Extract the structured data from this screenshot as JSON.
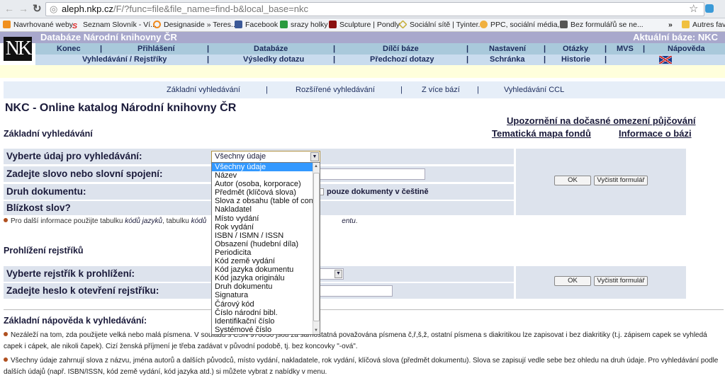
{
  "browser": {
    "url_host": "aleph.nkp.cz",
    "url_path": "/F/?func=file&file_name=find-b&local_base=nkc",
    "bookmarks": [
      "Navrhované weby",
      "Seznam Slovník - Ví...",
      "Designaside » Teres...",
      "Facebook",
      "srazy holky",
      "Sculpture | Pondly",
      "Sociální sítě | Tyinter...",
      "PPC, sociální média,...",
      "Bez formulářů se ne...",
      "»",
      "Autres favo"
    ]
  },
  "header": {
    "title": "Databáze Národní knihovny ČR",
    "current_base": "Aktuální báze:  NKC",
    "logo": "NK"
  },
  "nav1": [
    "Konec",
    "Přihlášení",
    "Databáze",
    "Dílčí báze",
    "Nastavení",
    "Otázky",
    "MVS",
    "Nápověda"
  ],
  "nav2": [
    "Vyhledávání / Rejstříky",
    "Výsledky dotazu",
    "Předchozí dotazy",
    "Schránka",
    "Historie"
  ],
  "submenu": [
    "Základní vyhledávání",
    "Rozšířené vyhledávání",
    "Z více bází",
    "Vyhledávání CCL"
  ],
  "page_title": "NKC -  Online katalog Národní knihovny ČR",
  "links": {
    "notice": "Upozornění na dočasné omezení půjčování",
    "map": "Tematická mapa fondů",
    "info": "Informace o bázi"
  },
  "search": {
    "heading": "Základní vyhledávání",
    "labels": [
      "Vyberte údaj pro vyhledávání:",
      "Zadejte slovo nebo slovní spojení:",
      "Druh dokumentu:",
      "Blízkost slov?"
    ],
    "selected": "Všechny údaje",
    "czech_only": "pouze dokumenty v češtině",
    "ok": "OK",
    "clear": "Vyčistit formulář",
    "options": [
      "Všechny údaje",
      "Název",
      "Autor (osoba, korporace)",
      "Předmět (klíčová slova)",
      "Slova z obsahu (table of cont.)",
      "Nakladatel",
      "Místo vydání",
      "Rok vydání",
      "ISBN / ISMN / ISSN",
      "Obsazení (hudební díla)",
      "Periodicita",
      "Kód země vydání",
      "Kód jazyka dokumentu",
      "Kód jazyka originálu",
      "Druh dokumentu",
      "Signatura",
      "Čárový kód",
      "Číslo národní bibl.",
      "Identifikační číslo",
      "Systémové číslo"
    ]
  },
  "note": {
    "pre": "Pro další informace použijte tabulku ",
    "l1": "kódů jazyků",
    "mid": ", tabulku ",
    "l2": "kódů",
    "end": "entu",
    "dot": "."
  },
  "browse": {
    "heading": "Prohlížení rejstříků",
    "labels": [
      "Vyberte rejstřík k prohlížení:",
      "Zadejte heslo k otevření rejstříku:"
    ],
    "ok": "OK",
    "clear": "Vyčistit formulář"
  },
  "help": {
    "heading": "Základní nápověda k vyhledávání:",
    "p1": "Nezáleží na tom, zda použijete velká nebo malá písmena. V souladu s ČSN 976030 jsou za samostatná považována písmena č,ř,š,ž, ostatní písmena s diakritikou lze zapisovat i bez diakritiky (t.j. zápisem capek se vyhledá capek i cápek, ale nikoli čapek). Cizí ženská příjmení je třeba zadávat v původní podobě, tj. bez koncovky \"-ová\".",
    "p2": "Všechny údaje zahrnují slova z názvu, jména autorů a dalších původců, místo vydání, nakladatele, rok vydání, klíčová slova (předmět dokumentu). Slova se zapisují vedle sebe bez ohledu na druh údaje. Pro vyhledávání podle dalších údajů (např. ISBN/ISSN, kód země vydání, kód jazyka atd.) si můžete vybrat z nabídky v menu."
  },
  "colors": {
    "header": "#a8a8cc",
    "nav1": "#a9c9db",
    "nav2": "#c9dcee",
    "form_row": "#dde3ed",
    "selection": "#3399ff"
  }
}
